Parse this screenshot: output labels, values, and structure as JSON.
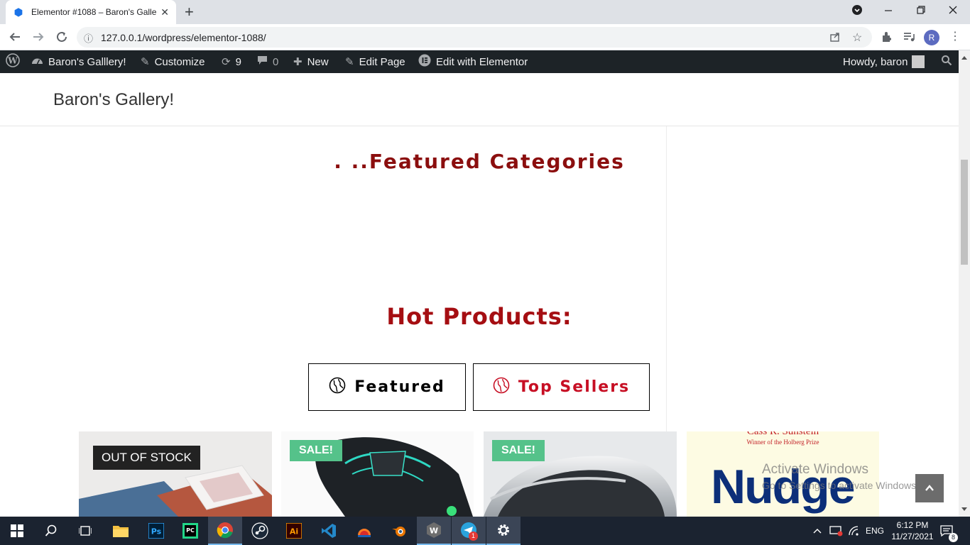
{
  "browser": {
    "tab_title": "Elementor #1088 – Baron's Galle",
    "close_tab": "✕",
    "new_tab": "+",
    "url": "127.0.0.1/wordpress/elementor-1088/",
    "profile_initial": "R"
  },
  "adminbar": {
    "site_name": "Baron's Galllery!",
    "customize": "Customize",
    "updates_count": "9",
    "comments_count": "0",
    "new": "New",
    "edit_page": "Edit Page",
    "edit_elementor": "Edit with Elementor",
    "howdy": "Howdy, baron"
  },
  "site": {
    "title": "Baron's Gallery!"
  },
  "main": {
    "featured_heading": ". ..Featured Categories",
    "hot_heading": "Hot Products:",
    "tabs": [
      {
        "label": "Featured",
        "color": "#000000"
      },
      {
        "label": "Top Sellers",
        "color": "#c70f24"
      }
    ]
  },
  "products": [
    {
      "badge": "OUT OF STOCK",
      "image": "leather bags photo"
    },
    {
      "badge": "SALE!",
      "image": "gaming mouse photo"
    },
    {
      "badge": "SALE!",
      "image": "grey mouse photo"
    },
    {
      "badge": "",
      "image": "Nudge book cover",
      "book_author": "Cass R. Sunstein",
      "book_subtitle": "Winner of the Holberg Prize",
      "book_title": "Nudge"
    }
  ],
  "watermark": {
    "line1": "Activate Windows",
    "line2": "Go to Settings to activate Windows."
  },
  "taskbar": {
    "lang": "ENG",
    "time": "6:12 PM",
    "date": "11/27/2021",
    "notifications": "8",
    "telegram_badge": "1"
  }
}
